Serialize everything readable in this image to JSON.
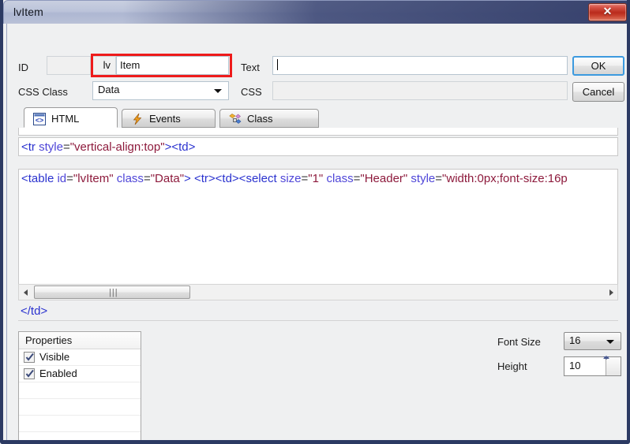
{
  "window": {
    "title": "lvItem",
    "close_label": "✕"
  },
  "form": {
    "id_label": "ID",
    "id_value": "",
    "prefix_value": "lv",
    "name_value": "Item",
    "css_class_label": "CSS Class",
    "css_class_value": "Data",
    "text_label": "Text",
    "text_value": "",
    "css_label": "CSS",
    "css_value": ""
  },
  "buttons": {
    "ok": "OK",
    "cancel": "Cancel"
  },
  "tabs": [
    {
      "label": "HTML",
      "icon": "code-brackets-icon",
      "active": true
    },
    {
      "label": "Events",
      "icon": "lightning-bolt-icon",
      "active": false
    },
    {
      "label": "Class",
      "icon": "shapes-icon",
      "active": false
    }
  ],
  "code": {
    "top_line": [
      {
        "t": "<tr ",
        "c": "tag"
      },
      {
        "t": "style",
        "c": "attr"
      },
      {
        "t": "=",
        "c": "eq"
      },
      {
        "t": "\"vertical-align:top\"",
        "c": "val"
      },
      {
        "t": "><td>",
        "c": "tag"
      }
    ],
    "main_line": [
      {
        "t": "<table ",
        "c": "tag"
      },
      {
        "t": "id",
        "c": "attr"
      },
      {
        "t": "=",
        "c": "eq"
      },
      {
        "t": "\"lvItem\"",
        "c": "val"
      },
      {
        "t": " ",
        "c": "eq"
      },
      {
        "t": "class",
        "c": "attr"
      },
      {
        "t": "=",
        "c": "eq"
      },
      {
        "t": "\"Data\"",
        "c": "val"
      },
      {
        "t": ">  <tr><td><select ",
        "c": "tag"
      },
      {
        "t": "size",
        "c": "attr"
      },
      {
        "t": "=",
        "c": "eq"
      },
      {
        "t": "\"1\"",
        "c": "val"
      },
      {
        "t": " ",
        "c": "eq"
      },
      {
        "t": "class",
        "c": "attr"
      },
      {
        "t": "=",
        "c": "eq"
      },
      {
        "t": "\"Header\"",
        "c": "val"
      },
      {
        "t": " ",
        "c": "eq"
      },
      {
        "t": "style",
        "c": "attr"
      },
      {
        "t": "=",
        "c": "eq"
      },
      {
        "t": "\"width:0px;font-size:16p",
        "c": "val"
      }
    ],
    "bottom_line": [
      {
        "t": "</td>",
        "c": "tag"
      }
    ]
  },
  "properties": {
    "header": "Properties",
    "rows": [
      {
        "label": "Visible",
        "checked": true
      },
      {
        "label": "Enabled",
        "checked": true
      },
      {
        "label": "",
        "checked": false
      },
      {
        "label": "",
        "checked": false
      },
      {
        "label": "",
        "checked": false
      },
      {
        "label": "",
        "checked": false
      }
    ]
  },
  "settings": {
    "font_size_label": "Font Size",
    "font_size_value": "16",
    "height_label": "Height",
    "height_value": "10"
  },
  "colors": {
    "accent": "#3c9adf",
    "highlight": "#ee1b1b",
    "titlebar": "#3c4877",
    "close": "#b92b1c"
  }
}
